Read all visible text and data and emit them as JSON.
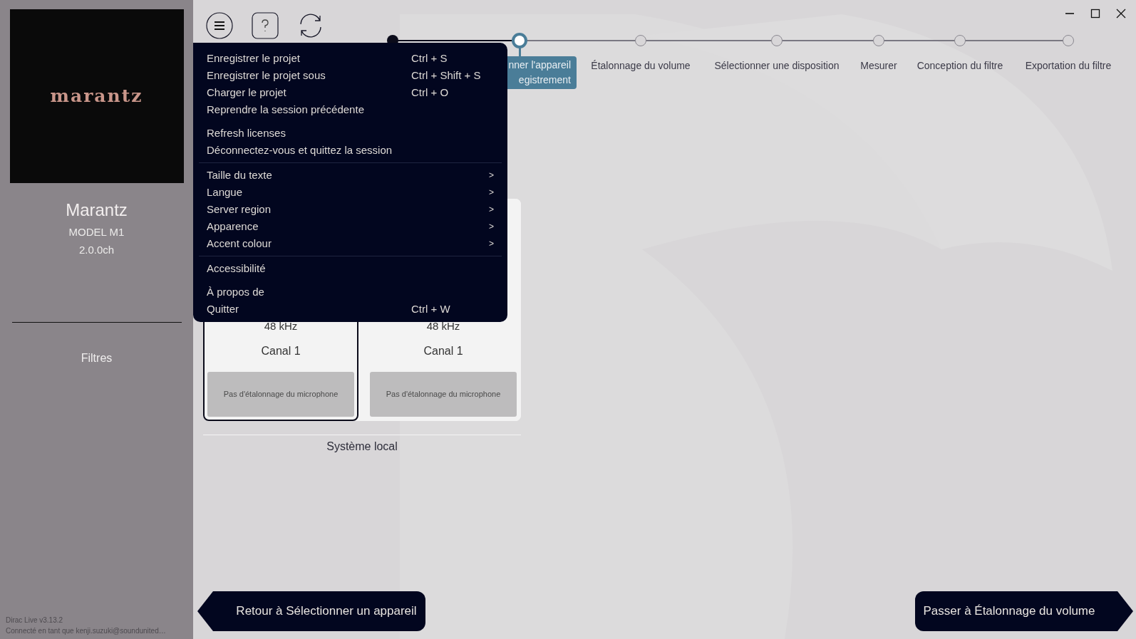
{
  "sidebar": {
    "logo": "marantz",
    "device_name": "Marantz",
    "model": "MODEL M1",
    "channels": "2.0.0ch",
    "nav_items": [
      {
        "label": "Filtres"
      }
    ],
    "version": "Dirac Live v3.13.2",
    "account": "Connecté en tant que kenji.suzuki@soundunited…"
  },
  "stepper": {
    "steps": [
      {
        "done": true,
        "selected": false
      },
      {
        "done": false,
        "selected": true,
        "label_lines": [
          "nner l'appareil",
          "egistrement"
        ]
      },
      {
        "done": false,
        "selected": false,
        "label_lines": [
          "Étalonnage du volume"
        ]
      },
      {
        "done": false,
        "selected": false,
        "label_lines": [
          "Sélectionner une disposition"
        ]
      },
      {
        "done": false,
        "selected": false,
        "label_lines": [
          "Mesurer"
        ]
      },
      {
        "done": false,
        "selected": false,
        "label_lines": [
          "Conception du filtre"
        ]
      },
      {
        "done": false,
        "selected": false,
        "label_lines": [
          "Exportation du filtre"
        ]
      }
    ]
  },
  "menu": {
    "groups": [
      {
        "blocks": [
          {
            "items": [
              {
                "label": "Enregistrer le projet",
                "shortcut": "Ctrl + S"
              },
              {
                "label": "Enregistrer le projet sous",
                "shortcut": "Ctrl + Shift + S"
              },
              {
                "label": "Charger le projet",
                "shortcut": "Ctrl + O"
              },
              {
                "label": "Reprendre la session précédente"
              }
            ]
          },
          {
            "items": [
              {
                "label": "Refresh licenses"
              },
              {
                "label": "Déconnectez-vous et quittez la session"
              }
            ]
          }
        ]
      },
      {
        "blocks": [
          {
            "items": [
              {
                "label": "Taille du texte",
                "arrow": ">"
              },
              {
                "label": "Langue",
                "arrow": ">"
              },
              {
                "label": "Server region",
                "arrow": ">"
              },
              {
                "label": "Apparence",
                "arrow": ">"
              },
              {
                "label": "Accent colour",
                "arrow": ">"
              }
            ]
          }
        ]
      },
      {
        "blocks": [
          {
            "items": [
              {
                "label": "Accessibilité"
              }
            ]
          },
          {
            "items": [
              {
                "label": "À propos de"
              },
              {
                "label": "Quitter",
                "shortcut": "Ctrl + W"
              }
            ]
          }
        ]
      }
    ]
  },
  "cards": [
    {
      "selected": true,
      "rate": "48 kHz",
      "channel": "Canal 1",
      "calibration": "Pas d'étalonnage du microphone"
    },
    {
      "selected": false,
      "rate": "48 kHz",
      "channel": "Canal 1",
      "calibration": "Pas d'étalonnage du microphone"
    }
  ],
  "group_label": "Système local",
  "back_button": "Retour à Sélectionner un appareil",
  "next_button": "Passer à Étalonnage du volume"
}
